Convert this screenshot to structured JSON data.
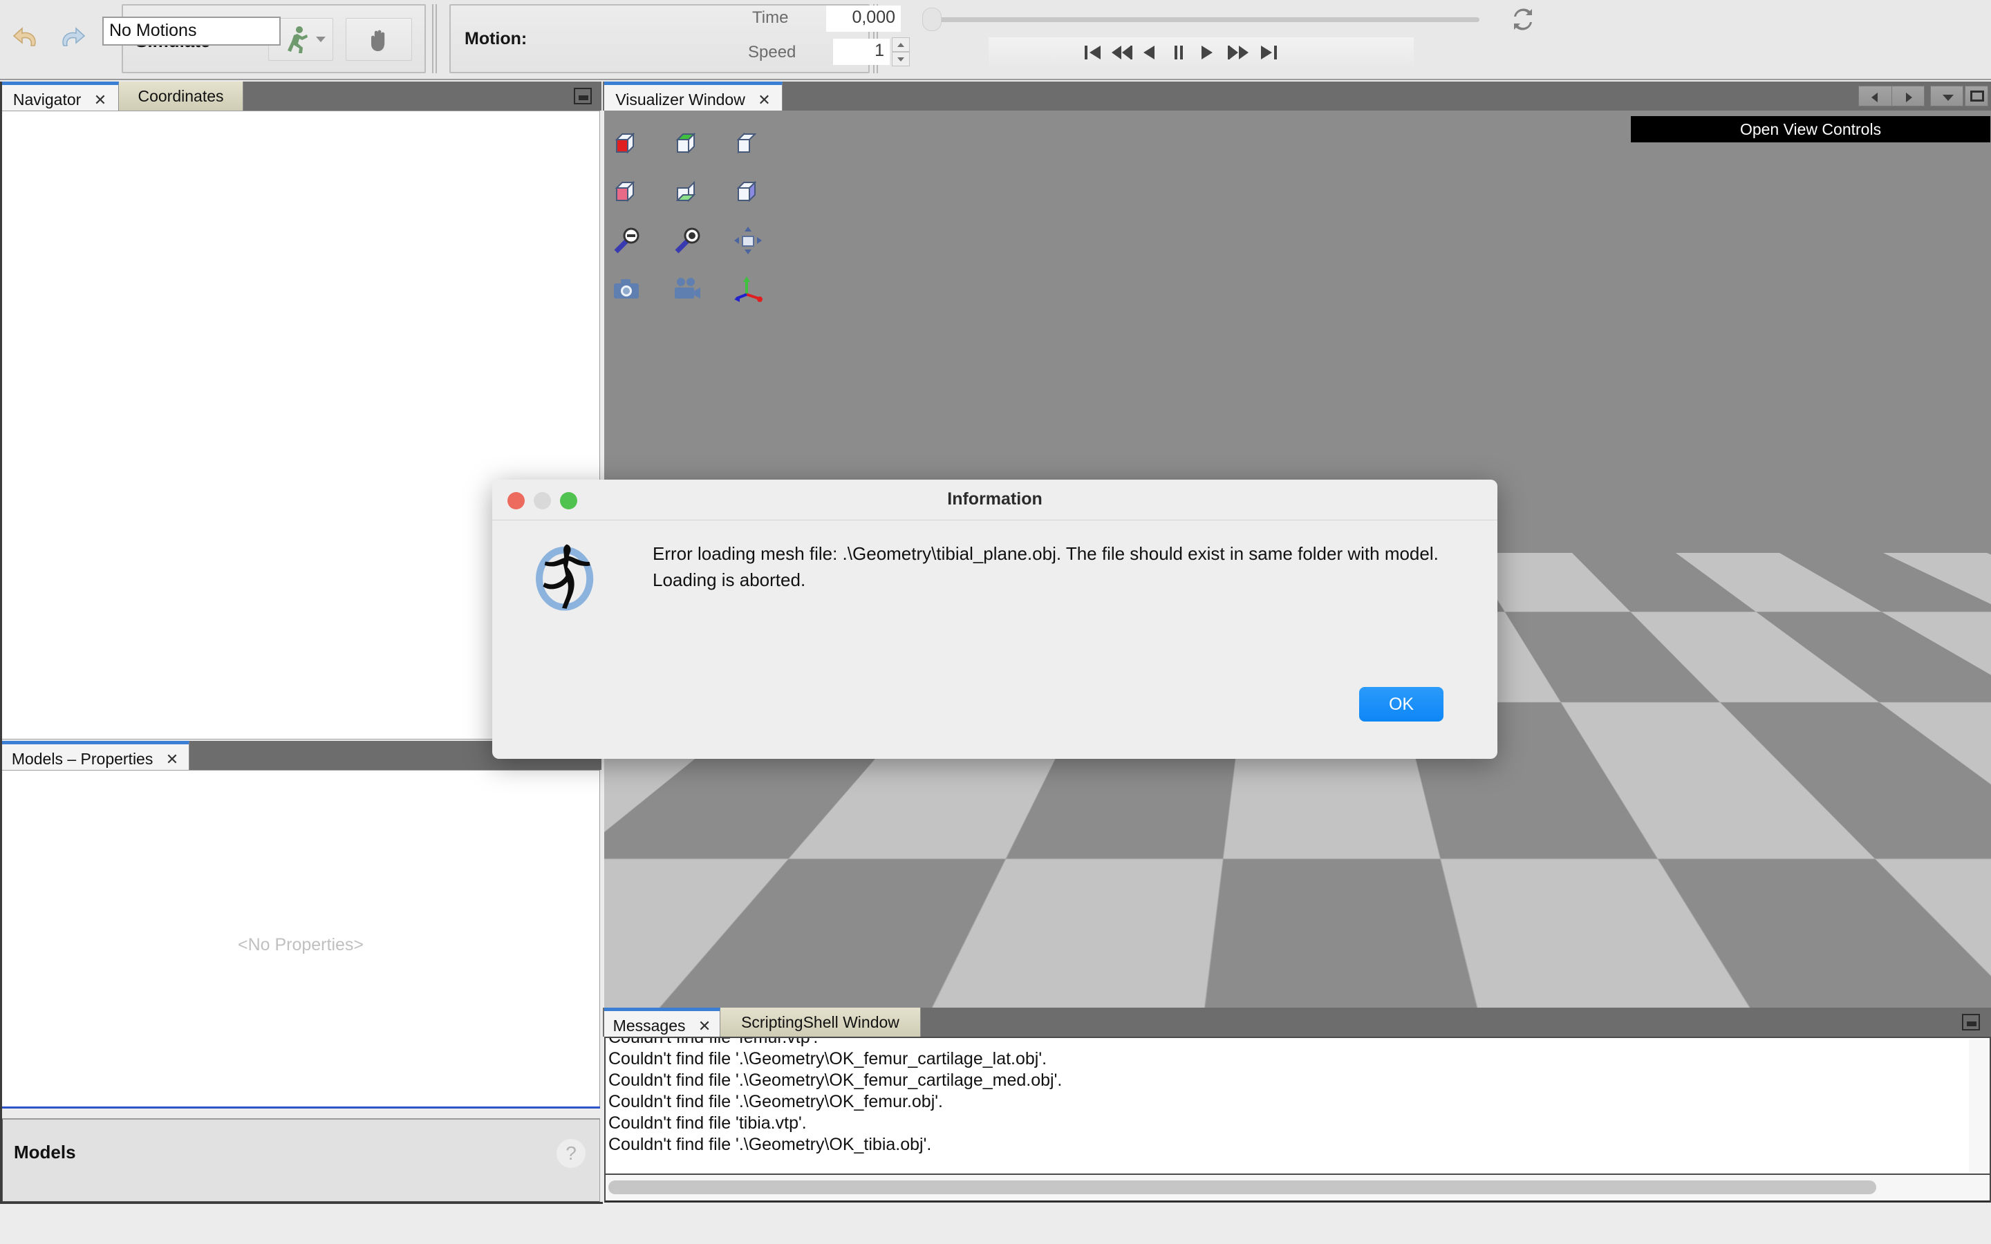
{
  "toolbar": {
    "undo_icon": "undo-icon",
    "redo_icon": "redo-icon",
    "simulate_label": "Simulate",
    "run_icon": "running-man-icon",
    "pan_icon": "hand-icon",
    "motion_label": "Motion:",
    "motion_value": "No Motions",
    "time_label": "Time",
    "time_value": "0,000",
    "speed_label": "Speed",
    "speed_value": "1",
    "loop_icon": "loop-repeat-icon",
    "transport": [
      {
        "name": "skip-to-start-button",
        "glyph": "⏮"
      },
      {
        "name": "step-back-button",
        "glyph": "◀❘"
      },
      {
        "name": "play-backward-button",
        "glyph": "◀"
      },
      {
        "name": "pause-button",
        "glyph": "❙❙"
      },
      {
        "name": "play-button",
        "glyph": "▶"
      },
      {
        "name": "step-forward-button",
        "glyph": "❘▶"
      },
      {
        "name": "skip-to-end-button",
        "glyph": "⏭"
      }
    ]
  },
  "left": {
    "tabs": [
      {
        "label": "Navigator",
        "closable": true,
        "active": true
      },
      {
        "label": "Coordinates",
        "closable": false,
        "active": false
      }
    ],
    "properties_tabs": [
      {
        "label": "Models – Properties",
        "closable": true,
        "active": true
      }
    ],
    "no_properties_text": "<No Properties>",
    "models_section_title": "Models",
    "help_glyph": "?"
  },
  "visualizer": {
    "tabs": [
      {
        "label": "Visualizer Window",
        "closable": true,
        "active": true
      }
    ],
    "open_view_controls_label": "Open View Controls",
    "nav_buttons": [
      {
        "name": "nav-back-button",
        "glyph": "◀"
      },
      {
        "name": "nav-forward-button",
        "glyph": "▶"
      },
      {
        "name": "nav-dropdown-button",
        "glyph": "▼"
      },
      {
        "name": "maximize-window-button",
        "glyph": "▣"
      }
    ],
    "view_icons": [
      {
        "name": "view-front-cube-icon",
        "color": "#e02020"
      },
      {
        "name": "view-top-cube-icon",
        "color": "#3fc03f"
      },
      {
        "name": "view-left-cube-icon",
        "color": "#2222cc"
      },
      {
        "name": "view-back-cube-icon",
        "color": "#e86a86"
      },
      {
        "name": "view-bottom-cube-icon",
        "color": "#8ae08a"
      },
      {
        "name": "view-right-cube-icon",
        "color": "#8a8ae0"
      },
      {
        "name": "zoom-out-icon",
        "color": "#3a3ab0"
      },
      {
        "name": "zoom-in-icon",
        "color": "#3a3ab0"
      },
      {
        "name": "fit-to-window-icon",
        "color": "#7d8fb8"
      },
      {
        "name": "snapshot-camera-icon",
        "color": "#5f7fb0"
      },
      {
        "name": "record-video-icon",
        "color": "#5f7fb0"
      },
      {
        "name": "toggle-axes-icon",
        "color": "#3fc03f"
      }
    ],
    "floor_light_color": "#c3c3c3",
    "floor_dark_color": "#8c8c8c",
    "watermark_icon": "opensim-logo-watermark"
  },
  "messages": {
    "tabs": [
      {
        "label": "Messages",
        "closable": true,
        "active": true
      },
      {
        "label": "ScriptingShell Window",
        "closable": false,
        "active": false
      }
    ],
    "lines": [
      "Couldn't find file 'femur.vtp'.",
      "Couldn't find file '.\\Geometry\\OK_femur_cartilage_lat.obj'.",
      "Couldn't find file '.\\Geometry\\OK_femur_cartilage_med.obj'.",
      "Couldn't find file '.\\Geometry\\OK_femur.obj'.",
      "Couldn't find file 'tibia.vtp'.",
      "Couldn't find file '.\\Geometry\\OK_tibia.obj'."
    ]
  },
  "dialog": {
    "title": "Information",
    "logo_icon": "opensim-logo-icon",
    "message_line1": "Error loading mesh file: .\\Geometry\\tibial_plane.obj. The file should exist in same folder with model.",
    "message_line2": " Loading is aborted.",
    "ok_label": "OK",
    "traffic_close_color": "#ec6a5e",
    "traffic_min_color": "#d9d9d9",
    "traffic_max_color": "#4fc24f",
    "ok_button_color": "#0d86f6"
  }
}
